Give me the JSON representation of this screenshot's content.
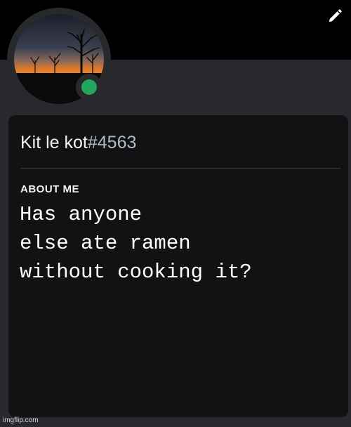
{
  "profile": {
    "display_name": "Kit le kot",
    "discriminator": "#4563",
    "status": "online",
    "status_color": "#23a55a"
  },
  "about_me": {
    "heading": "ABOUT ME",
    "text": "Has anyone\nelse ate ramen\nwithout cooking it?"
  },
  "watermark": "imgflip.com",
  "icons": {
    "edit": "pencil-icon"
  },
  "colors": {
    "banner": "#000000",
    "background": "#27292d",
    "card": "#111214",
    "text": "#f2f3f5",
    "discriminator": "#b5bac1"
  }
}
